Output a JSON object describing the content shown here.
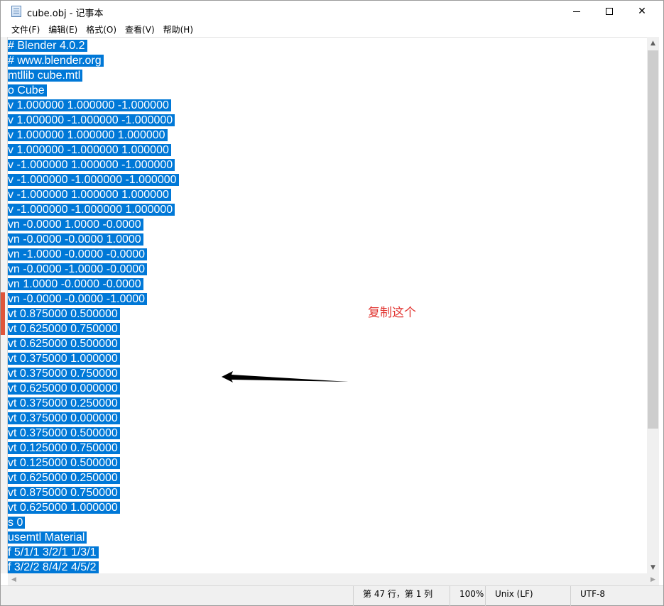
{
  "window": {
    "title": "cube.obj - 记事本",
    "controls": {
      "minimize": "minimize-icon",
      "maximize": "maximize-icon",
      "close": "close-icon"
    }
  },
  "menu": {
    "items": [
      "文件(F)",
      "编辑(E)",
      "格式(O)",
      "查看(V)",
      "帮助(H)"
    ]
  },
  "editor": {
    "selection_color": "#0078d7",
    "lines": [
      "# Blender 4.0.2",
      "# www.blender.org",
      "mtllib cube.mtl",
      "o Cube",
      "v 1.000000 1.000000 -1.000000",
      "v 1.000000 -1.000000 -1.000000",
      "v 1.000000 1.000000 1.000000",
      "v 1.000000 -1.000000 1.000000",
      "v -1.000000 1.000000 -1.000000",
      "v -1.000000 -1.000000 -1.000000",
      "v -1.000000 1.000000 1.000000",
      "v -1.000000 -1.000000 1.000000",
      "vn -0.0000 1.0000 -0.0000",
      "vn -0.0000 -0.0000 1.0000",
      "vn -1.0000 -0.0000 -0.0000",
      "vn -0.0000 -1.0000 -0.0000",
      "vn 1.0000 -0.0000 -0.0000",
      "vn -0.0000 -0.0000 -1.0000",
      "vt 0.875000 0.500000",
      "vt 0.625000 0.750000",
      "vt 0.625000 0.500000",
      "vt 0.375000 1.000000",
      "vt 0.375000 0.750000",
      "vt 0.625000 0.000000",
      "vt 0.375000 0.250000",
      "vt 0.375000 0.000000",
      "vt 0.375000 0.500000",
      "vt 0.125000 0.750000",
      "vt 0.125000 0.500000",
      "vt 0.625000 0.250000",
      "vt 0.875000 0.750000",
      "vt 0.625000 1.000000",
      "s 0",
      "usemtl Material",
      "f 5/1/1 3/2/1 1/3/1",
      "f 3/2/2 8/4/2 4/5/2"
    ]
  },
  "annotation": {
    "text": "复制这个",
    "color": "#e1332f"
  },
  "statusbar": {
    "position": "第 47 行，第 1 列",
    "zoom": "100%",
    "line_ending": "Unix (LF)",
    "encoding": "UTF-8"
  }
}
